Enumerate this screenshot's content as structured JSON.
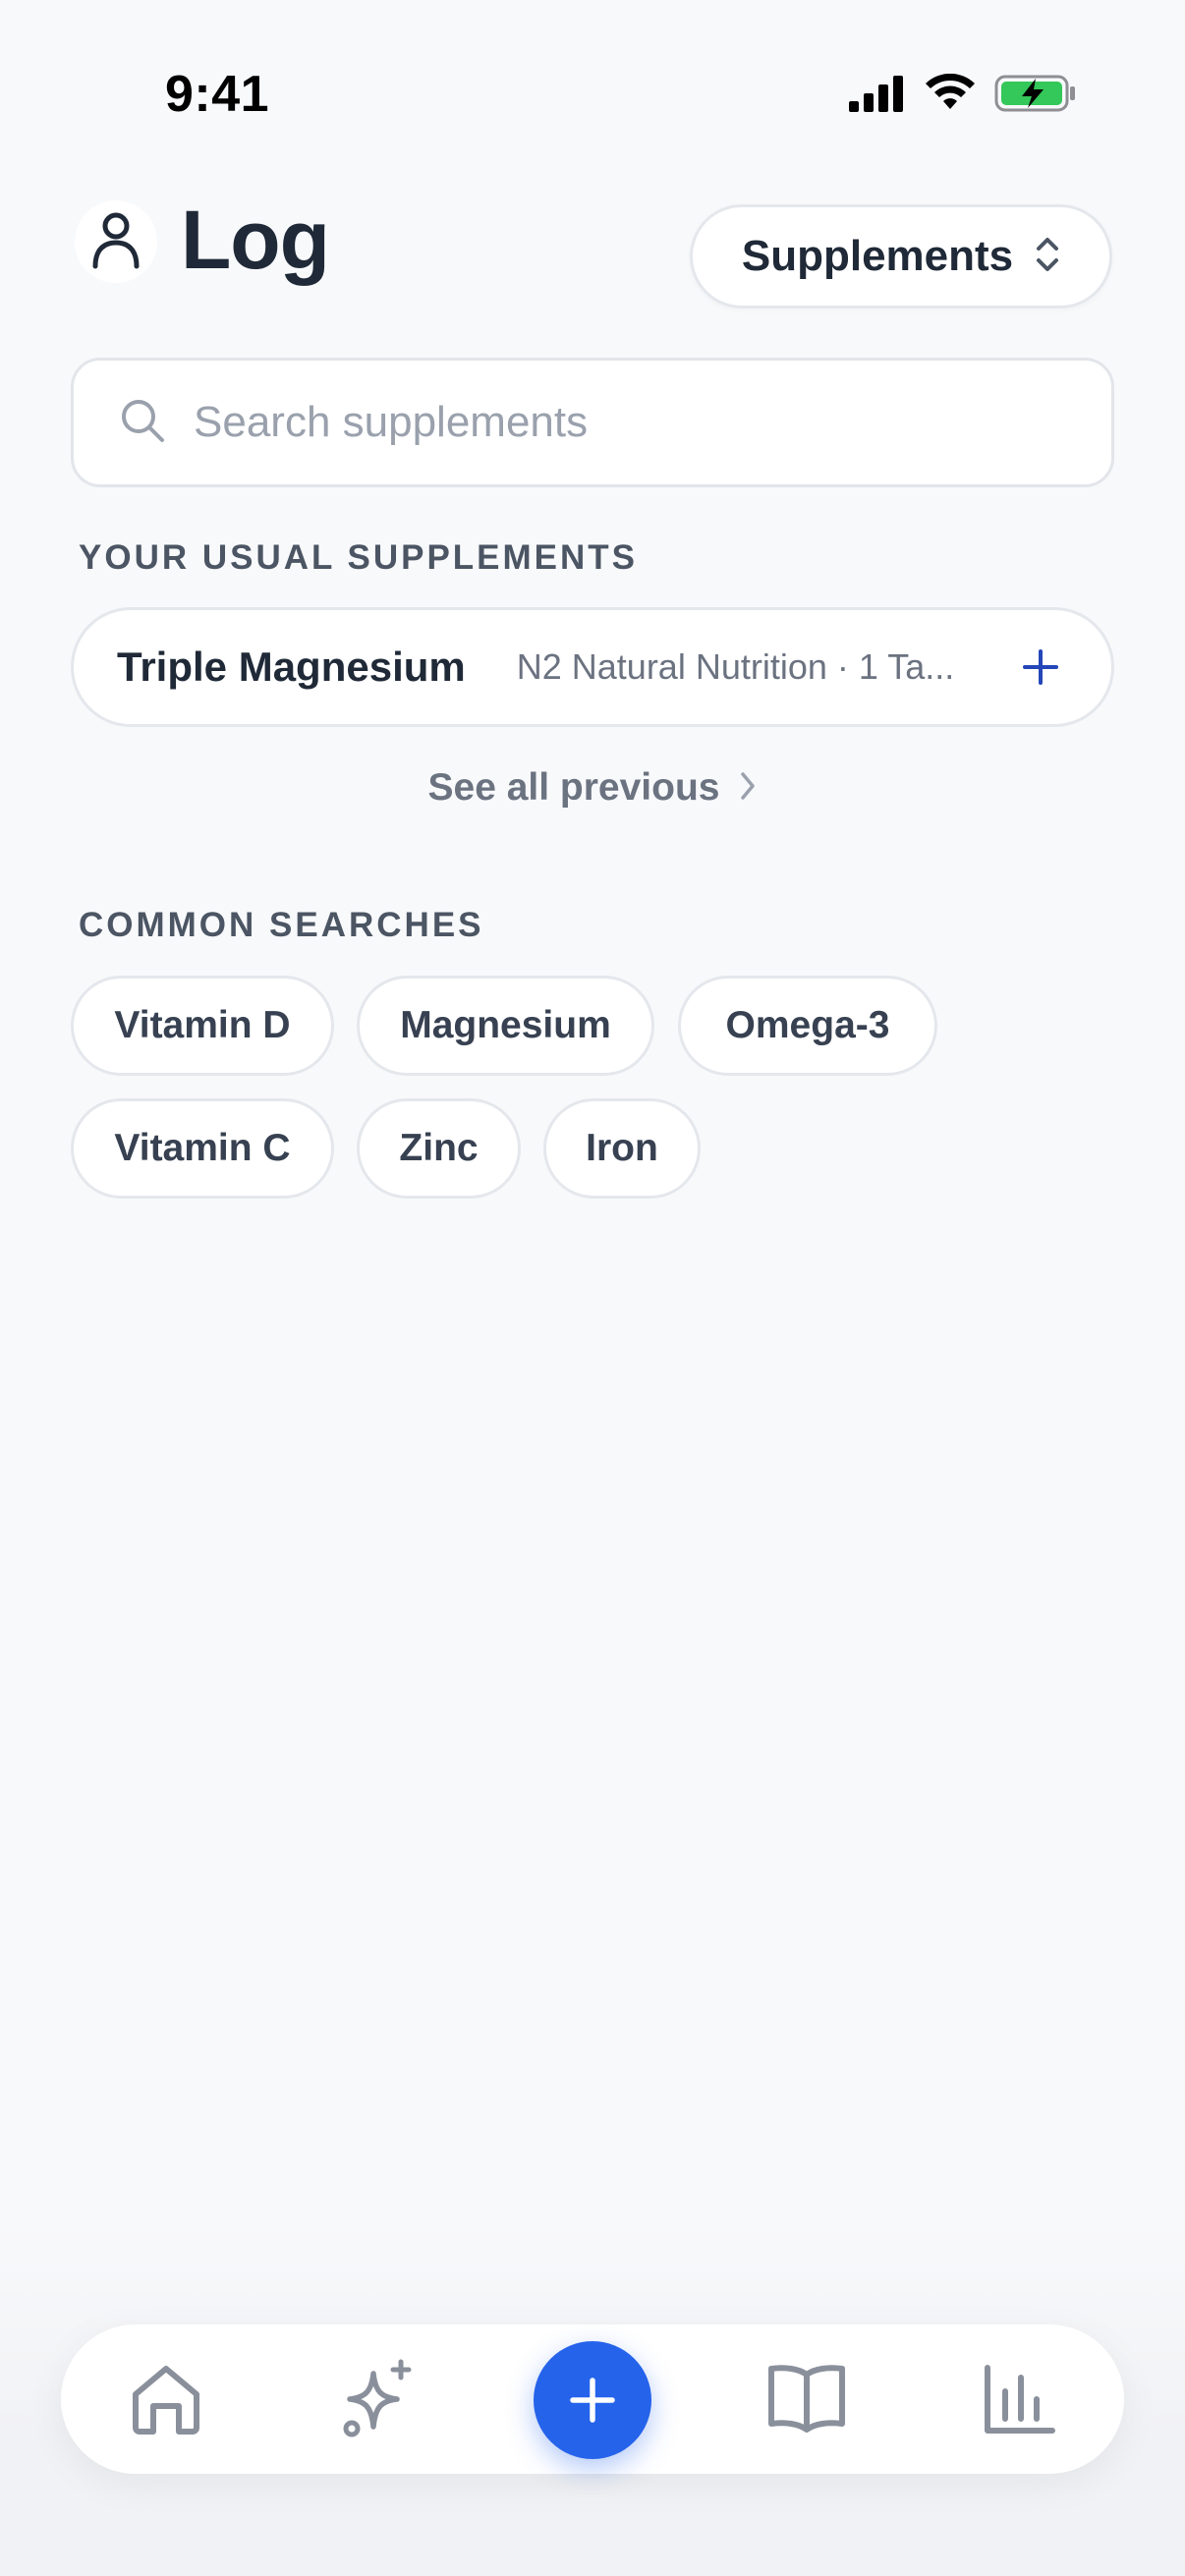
{
  "status_bar": {
    "time": "9:41"
  },
  "header": {
    "title": "Log",
    "category_selector": "Supplements",
    "profile_icon": "person-icon"
  },
  "search": {
    "placeholder": "Search supplements",
    "value": ""
  },
  "usual_section": {
    "heading": "YOUR USUAL SUPPLEMENTS",
    "items": [
      {
        "name": "Triple Magnesium",
        "detail": "N2 Natural Nutrition · 1 Ta..."
      }
    ],
    "see_all_label": "See all previous"
  },
  "common_section": {
    "heading": "COMMON SEARCHES",
    "chips": [
      "Vitamin D",
      "Magnesium",
      "Omega-3",
      "Vitamin C",
      "Zinc",
      "Iron"
    ]
  },
  "tab_bar": {
    "tabs": [
      "home-icon",
      "sparkles-icon",
      "plus-icon",
      "book-icon",
      "bar-chart-icon"
    ]
  },
  "colors": {
    "accent": "#2563eb",
    "background": "#f8f9fb",
    "text_primary": "#1f2937",
    "text_secondary": "#6b7280"
  }
}
